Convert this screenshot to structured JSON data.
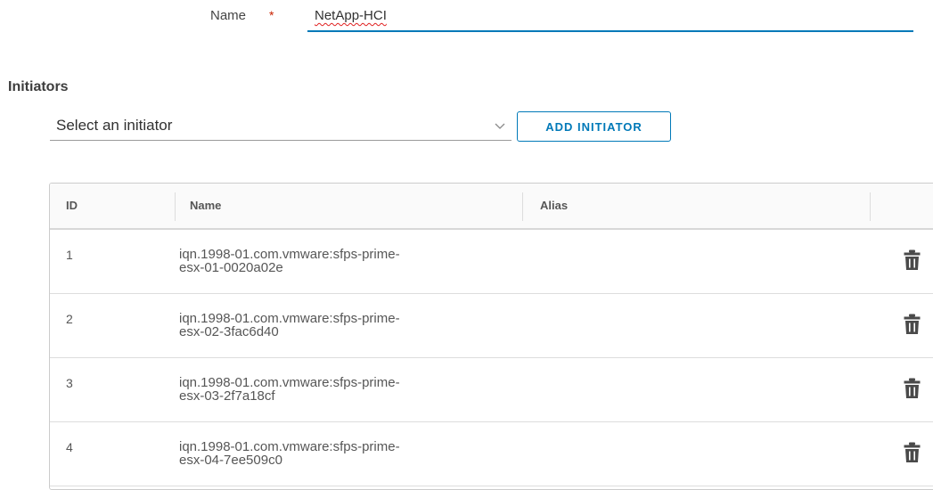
{
  "form": {
    "name_label": "Name",
    "required_marker": "*",
    "name_value": "NetApp-HCI"
  },
  "initiators": {
    "section_title": "Initiators",
    "select_placeholder": "Select an initiator",
    "add_button_label": "ADD INITIATOR"
  },
  "table": {
    "columns": [
      "ID",
      "Name",
      "Alias"
    ],
    "rows": [
      {
        "id": "1",
        "name_line1": "iqn.1998-01.com.vmware:sfps-prime-",
        "name_line2": "esx-01-0020a02e",
        "alias": ""
      },
      {
        "id": "2",
        "name_line1": "iqn.1998-01.com.vmware:sfps-prime-",
        "name_line2": "esx-02-3fac6d40",
        "alias": ""
      },
      {
        "id": "3",
        "name_line1": "iqn.1998-01.com.vmware:sfps-prime-",
        "name_line2": "esx-03-2f7a18cf",
        "alias": ""
      },
      {
        "id": "4",
        "name_line1": "iqn.1998-01.com.vmware:sfps-prime-",
        "name_line2": "esx-04-7ee509c0",
        "alias": ""
      }
    ]
  },
  "icons": {
    "row_action": "trash-icon",
    "select_arrow": "chevron-down-icon"
  },
  "colors": {
    "accent": "#0079b8",
    "required": "#c92100"
  }
}
